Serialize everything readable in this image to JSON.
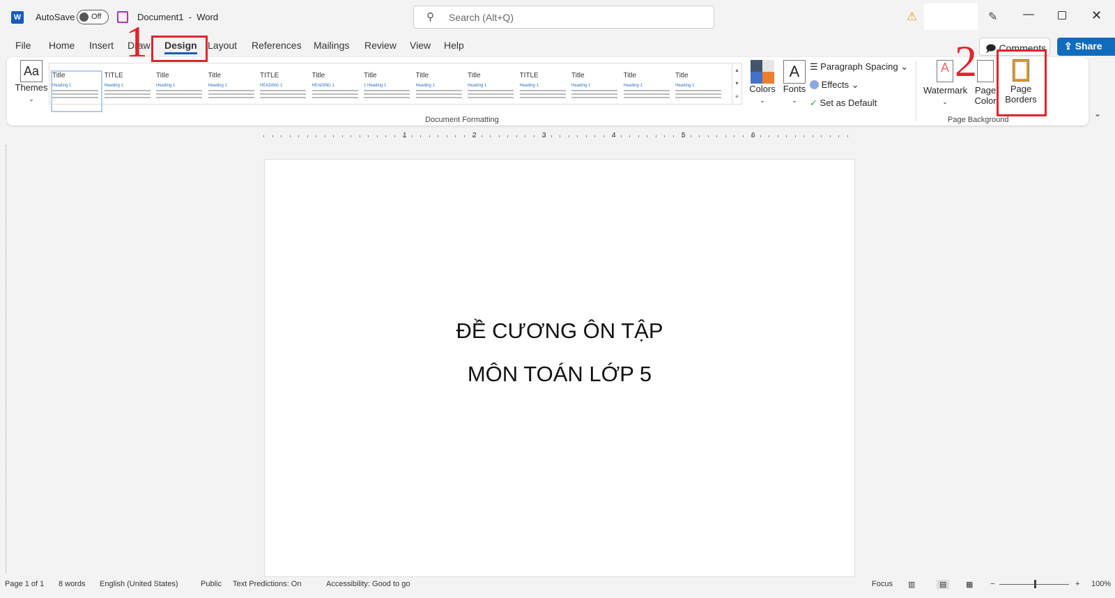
{
  "titlebar": {
    "autosave_label": "AutoSave",
    "toggle_state": "Off",
    "doc_title": "Document1  -  Word",
    "search_placeholder": "Search (Alt+Q)"
  },
  "tabs": [
    "File",
    "Home",
    "Insert",
    "Draw",
    "Design",
    "Layout",
    "References",
    "Mailings",
    "Review",
    "View",
    "Help"
  ],
  "active_tab": "Design",
  "comments_label": "Comments",
  "share_label": "Share",
  "ribbon": {
    "themes_label": "Themes",
    "style_thumbs": [
      {
        "title": "Title",
        "heading": "Heading 1"
      },
      {
        "title": "TITLE",
        "heading": "Heading 1"
      },
      {
        "title": "Title",
        "heading": "Heading 1"
      },
      {
        "title": "Title",
        "heading": "Heading 1"
      },
      {
        "title": "TITLE",
        "heading": "HEADING 1"
      },
      {
        "title": "Title",
        "heading": "HEADING 1"
      },
      {
        "title": "Title",
        "heading": "1 Heading 1"
      },
      {
        "title": "Title",
        "heading": "Heading 1"
      },
      {
        "title": "Title",
        "heading": "Heading 1"
      },
      {
        "title": "TITLE",
        "heading": "Heading 1"
      },
      {
        "title": "Title",
        "heading": "Heading 1"
      },
      {
        "title": "Title",
        "heading": "Heading 1"
      },
      {
        "title": "Title",
        "heading": "Heading 1"
      }
    ],
    "colors_label": "Colors",
    "fonts_label": "Fonts",
    "paragraph_spacing": "Paragraph Spacing",
    "effects": "Effects",
    "set_default": "Set as Default",
    "group_doc_formatting": "Document Formatting",
    "watermark": "Watermark",
    "page_color": "Page Color",
    "page_borders": "Page Borders",
    "group_page_background": "Page Background"
  },
  "annotations": {
    "step1": "1",
    "step2": "2",
    "accent": "#e0242b"
  },
  "ruler_numbers": [
    "1",
    "2",
    "3",
    "4",
    "5",
    "6"
  ],
  "document": {
    "line1": "ĐỀ CƯƠNG ÔN TẬP",
    "line2": "MÔN TOÁN LỚP 5"
  },
  "status": {
    "page": "Page 1 of 1",
    "words": "8 words",
    "language": "English (United States)",
    "sensitivity": "Public",
    "predictions": "Text Predictions: On",
    "accessibility": "Accessibility: Good to go",
    "focus": "Focus",
    "zoom": "100%",
    "zoom_level_percent": 100
  },
  "colors": {
    "brand": "#185abd",
    "share": "#0f6cbd"
  }
}
